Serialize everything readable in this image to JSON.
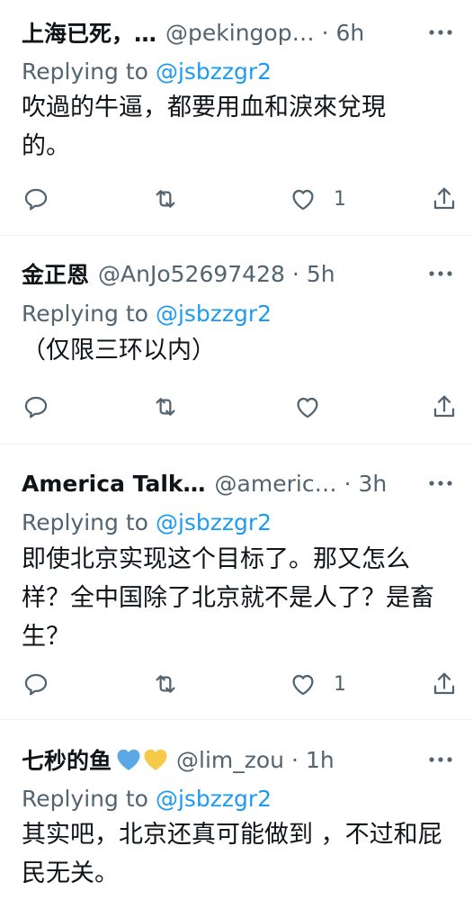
{
  "tweets": [
    {
      "display_name": "上海已死，…",
      "handle": "@pekingop…",
      "sep": "·",
      "time": "6h",
      "replying_label": "Replying to",
      "replying_to": "@jsbzzgr2",
      "body": "吹過的牛逼，都要用血和淚來兌現的。",
      "like_count": "1",
      "emoji": []
    },
    {
      "display_name": "金正恩",
      "handle": "@AnJo52697428",
      "sep": "·",
      "time": "5h",
      "replying_label": "Replying to",
      "replying_to": "@jsbzzgr2",
      "body": "（仅限三环以内）",
      "like_count": "",
      "emoji": []
    },
    {
      "display_name": "America Talk…",
      "handle": "@americ…",
      "sep": "·",
      "time": "3h",
      "replying_label": "Replying to",
      "replying_to": "@jsbzzgr2",
      "body": "即使北京实现这个目标了。那又怎么样？全中国除了北京就不是人了？是畜生？",
      "like_count": "1",
      "emoji": []
    },
    {
      "display_name": "七秒的鱼",
      "handle": "@lim_zou",
      "sep": "·",
      "time": "1h",
      "replying_label": "Replying to",
      "replying_to": "@jsbzzgr2",
      "body": "其实吧，北京还真可能做到 ，不过和屁民无关。",
      "like_count": "",
      "emoji": [
        "blue-heart-icon",
        "yellow-heart-icon"
      ]
    }
  ],
  "colors": {
    "text": "#0f1419",
    "muted": "#536471",
    "link": "#1d9bf0",
    "divider": "#eff3f4",
    "blue_heart": "#5aa9e6",
    "yellow_heart": "#f7c948"
  },
  "icons": {
    "reply": "reply-icon",
    "retweet": "retweet-icon",
    "like": "like-icon",
    "share": "share-icon",
    "more": "more-icon"
  }
}
